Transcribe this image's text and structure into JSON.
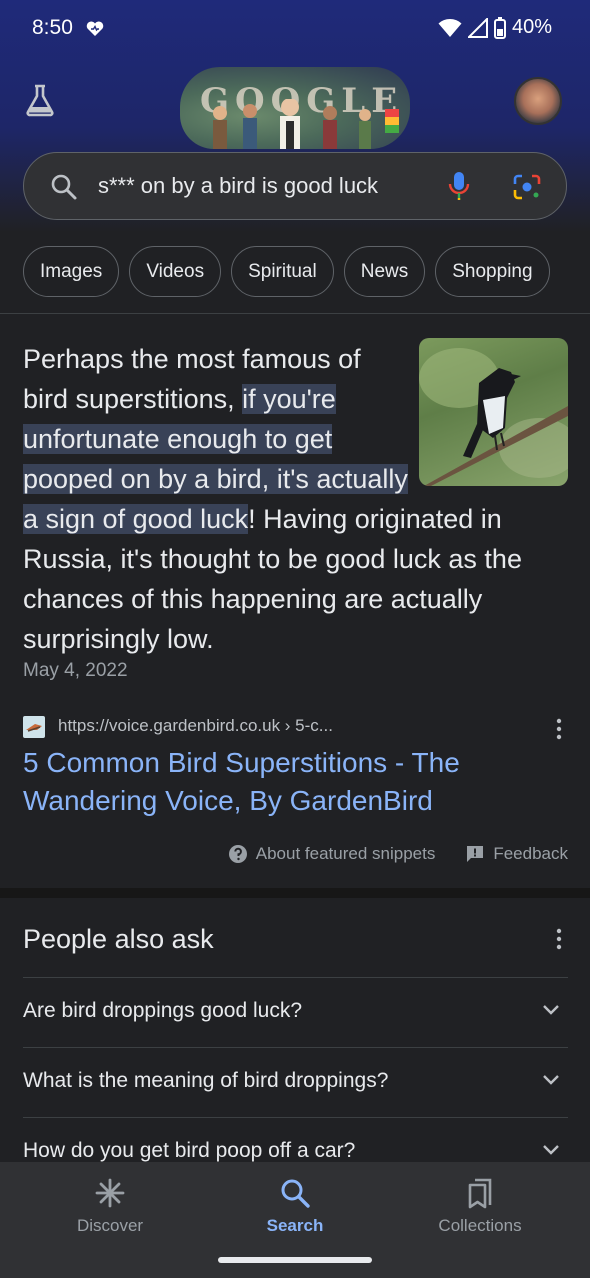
{
  "status_bar": {
    "time": "8:50",
    "battery": "40%"
  },
  "search": {
    "query": "s*** on by a bird is good luck"
  },
  "doodle": {
    "text": "GOOGLE"
  },
  "chips": [
    "Images",
    "Videos",
    "Spiritual",
    "News",
    "Shopping"
  ],
  "snippet": {
    "text_before": "Perhaps the most famous of bird superstitions, ",
    "text_highlight": "if you're unfortunate enough to get pooped on by a bird, it's actually a sign of good luck",
    "text_after": "! Having originated in Russia, it's thought to be good luck as the chances of this happening are actually surprisingly low.",
    "date": "May 4, 2022",
    "source_url": "https://voice.gardenbird.co.uk › 5-c...",
    "title": "5 Common Bird Superstitions - The Wandering Voice, By GardenBird",
    "about_label": "About featured snippets",
    "feedback_label": "Feedback"
  },
  "people_also_ask": {
    "title": "People also ask",
    "questions": [
      "Are bird droppings good luck?",
      "What is the meaning of bird droppings?",
      "How do you get bird poop off a car?"
    ]
  },
  "bottom_nav": {
    "discover": "Discover",
    "search": "Search",
    "collections": "Collections"
  },
  "colors": {
    "link": "#8ab4f8",
    "background": "#202124",
    "highlight": "#394257",
    "header": "#1f2a7a"
  },
  "icons": [
    "heart-icon",
    "wifi-icon",
    "signal-icon",
    "battery-icon",
    "lab-icon",
    "search-icon",
    "mic-icon",
    "lens-icon",
    "more-vert-icon",
    "help-icon",
    "feedback-icon",
    "chevron-down-icon",
    "discover-icon",
    "collections-icon"
  ]
}
